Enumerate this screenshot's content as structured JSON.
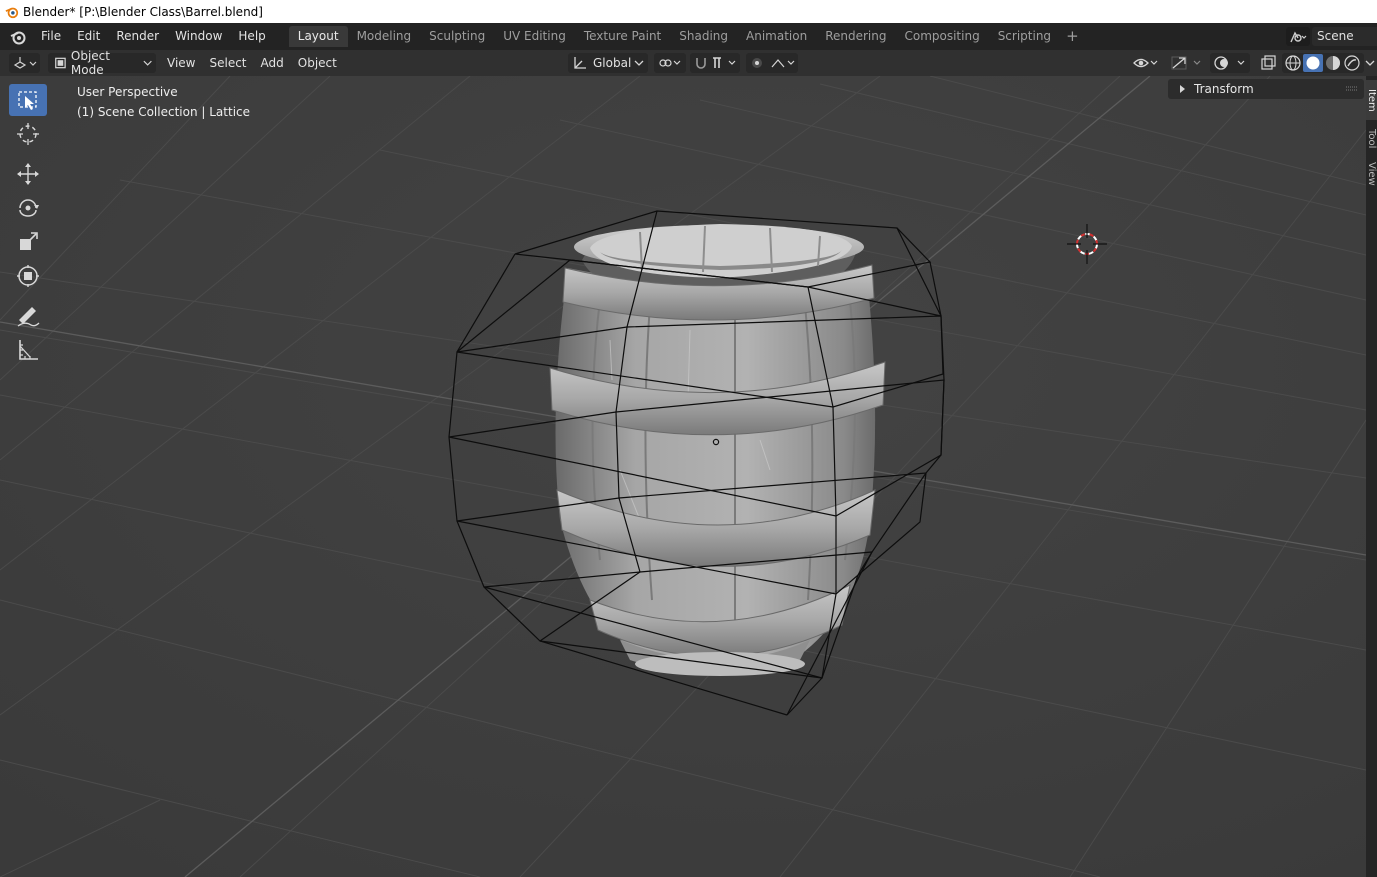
{
  "window": {
    "title": "Blender* [P:\\Blender Class\\Barrel.blend]"
  },
  "topbar": {
    "menus": [
      "File",
      "Edit",
      "Render",
      "Window",
      "Help"
    ],
    "workspace_tabs": [
      "Layout",
      "Modeling",
      "Sculpting",
      "UV Editing",
      "Texture Paint",
      "Shading",
      "Animation",
      "Rendering",
      "Compositing",
      "Scripting"
    ],
    "active_tab": "Layout",
    "add_tab": "+",
    "scene": "Scene"
  },
  "header": {
    "mode": "Object Mode",
    "menus": [
      "View",
      "Select",
      "Add",
      "Object"
    ],
    "orientation": "Global"
  },
  "viewport": {
    "view_name": "User Perspective",
    "collection_info": "(1) Scene Collection | Lattice"
  },
  "sidebar": {
    "panel": "Transform",
    "tabs": [
      "Item",
      "Tool",
      "View"
    ]
  },
  "colors": {
    "accent": "#4772b3",
    "background": "#3d3d3d",
    "topbar": "#232323"
  },
  "icons": [
    "blender-logo-icon",
    "select-box-icon",
    "cursor-icon",
    "move-icon",
    "rotate-icon",
    "scale-icon",
    "transform-icon",
    "annotate-icon",
    "measure-icon",
    "3d-cursor-icon"
  ]
}
